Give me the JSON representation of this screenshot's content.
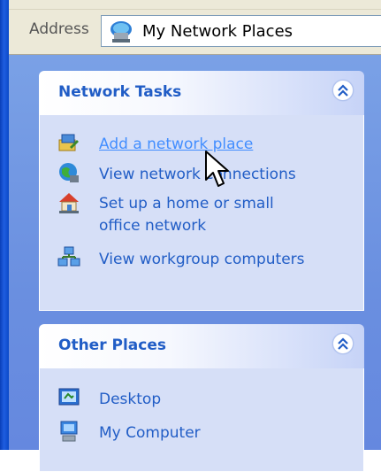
{
  "address": {
    "label": "Address",
    "value": "My Network Places",
    "icon": "network-places-icon"
  },
  "network_tasks": {
    "title": "Network Tasks",
    "collapse_icon": "chevron-up-double-icon",
    "items": [
      {
        "label": "Add a network place",
        "icon": "add-network-place-icon"
      },
      {
        "label": "View network connections",
        "icon": "network-connections-icon"
      },
      {
        "label_line1": "Set up a home or small",
        "label_line2": "office network",
        "icon": "home-network-icon"
      },
      {
        "label": "View workgroup computers",
        "icon": "workgroup-computers-icon"
      }
    ]
  },
  "other_places": {
    "title": "Other Places",
    "collapse_icon": "chevron-up-double-icon",
    "items": [
      {
        "label": "Desktop",
        "icon": "desktop-icon"
      },
      {
        "label": "My Computer",
        "icon": "my-computer-icon"
      }
    ]
  },
  "colors": {
    "pane": "#6a8fe0",
    "link": "#215dc6",
    "panel_body": "#d6dff7"
  }
}
